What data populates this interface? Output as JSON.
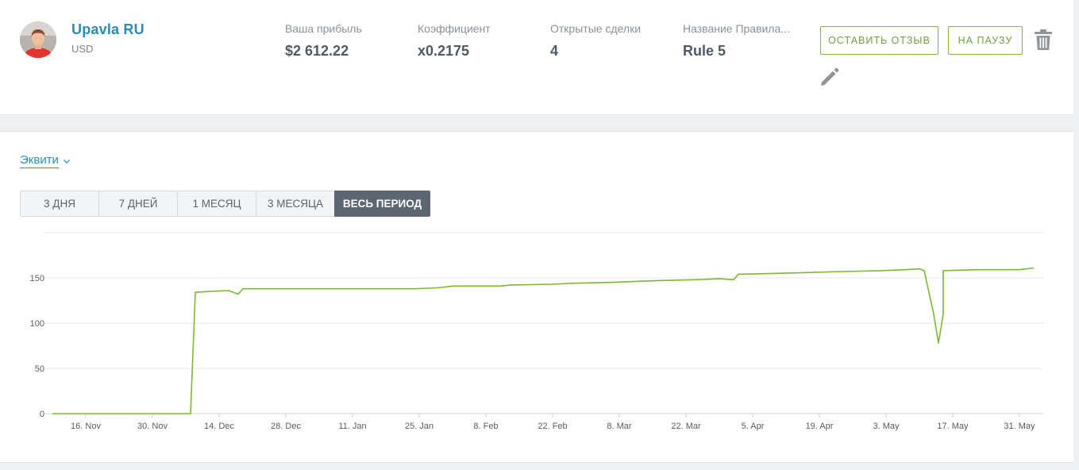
{
  "account": {
    "name": "Upavla RU",
    "currency": "USD",
    "avatar_icon": "user-avatar-photo"
  },
  "stats": [
    {
      "label": "Ваша прибыль",
      "value": "$2 612.22"
    },
    {
      "label": "Коэффициент",
      "value": "x0.2175"
    },
    {
      "label": "Открытые сделки",
      "value": "4"
    },
    {
      "label": "Название Правила...",
      "value": "Rule 5"
    }
  ],
  "actions": {
    "review_label": "ОСТАВИТЬ ОТЗЫВ",
    "pause_label": "НА ПАУЗУ",
    "delete_icon": "trash-icon",
    "edit_icon": "pencil-icon",
    "accent_color": "#7ab648"
  },
  "chart_section": {
    "dropdown_label": "Эквити",
    "periods": [
      "3 ДНЯ",
      "7 ДНЕЙ",
      "1 МЕСЯЦ",
      "3 МЕСЯЦА",
      "ВЕСЬ ПЕРИОД"
    ],
    "active_period": "ВЕСЬ ПЕРИОД"
  },
  "chart_data": {
    "type": "line",
    "title": "",
    "xlabel": "",
    "ylabel": "",
    "ylim": [
      0,
      200
    ],
    "yticks": [
      0,
      50,
      100,
      150
    ],
    "grid": true,
    "legend": "none",
    "xlim": [
      "2020-11-09",
      "2021-06-05"
    ],
    "xticks": [
      {
        "date": "2020-11-16",
        "label": "16. Nov"
      },
      {
        "date": "2020-11-30",
        "label": "30. Nov"
      },
      {
        "date": "2020-12-14",
        "label": "14. Dec"
      },
      {
        "date": "2020-12-28",
        "label": "28. Dec"
      },
      {
        "date": "2021-01-11",
        "label": "11. Jan"
      },
      {
        "date": "2021-01-25",
        "label": "25. Jan"
      },
      {
        "date": "2021-02-08",
        "label": "8. Feb"
      },
      {
        "date": "2021-02-22",
        "label": "22. Feb"
      },
      {
        "date": "2021-03-08",
        "label": "8. Mar"
      },
      {
        "date": "2021-03-22",
        "label": "22. Mar"
      },
      {
        "date": "2021-04-05",
        "label": "5. Apr"
      },
      {
        "date": "2021-04-19",
        "label": "19. Apr"
      },
      {
        "date": "2021-05-03",
        "label": "3. May"
      },
      {
        "date": "2021-05-17",
        "label": "17. May"
      },
      {
        "date": "2021-05-31",
        "label": "31. May"
      }
    ],
    "series": [
      {
        "color": "#7cb832",
        "points": [
          [
            "2020-11-09",
            0
          ],
          [
            "2020-12-08",
            0
          ],
          [
            "2020-12-09",
            134
          ],
          [
            "2020-12-12",
            135
          ],
          [
            "2020-12-16",
            136
          ],
          [
            "2020-12-18",
            132
          ],
          [
            "2020-12-19",
            138
          ],
          [
            "2021-01-05",
            138
          ],
          [
            "2021-01-24",
            138
          ],
          [
            "2021-01-29",
            139
          ],
          [
            "2021-02-01",
            141
          ],
          [
            "2021-02-11",
            141
          ],
          [
            "2021-02-13",
            142
          ],
          [
            "2021-02-22",
            143
          ],
          [
            "2021-02-26",
            144
          ],
          [
            "2021-03-06",
            145
          ],
          [
            "2021-03-16",
            147
          ],
          [
            "2021-03-24",
            148
          ],
          [
            "2021-03-29",
            149
          ],
          [
            "2021-04-01",
            148
          ],
          [
            "2021-04-02",
            154
          ],
          [
            "2021-04-10",
            155
          ],
          [
            "2021-04-17",
            156
          ],
          [
            "2021-04-24",
            157
          ],
          [
            "2021-05-02",
            158
          ],
          [
            "2021-05-07",
            159
          ],
          [
            "2021-05-10",
            160
          ],
          [
            "2021-05-11",
            158
          ],
          [
            "2021-05-13",
            110
          ],
          [
            "2021-05-14",
            78
          ],
          [
            "2021-05-15",
            110
          ],
          [
            "2021-05-15",
            158
          ],
          [
            "2021-05-22",
            159
          ],
          [
            "2021-05-28",
            159
          ],
          [
            "2021-05-31",
            159
          ],
          [
            "2021-06-03",
            161
          ]
        ]
      }
    ]
  }
}
